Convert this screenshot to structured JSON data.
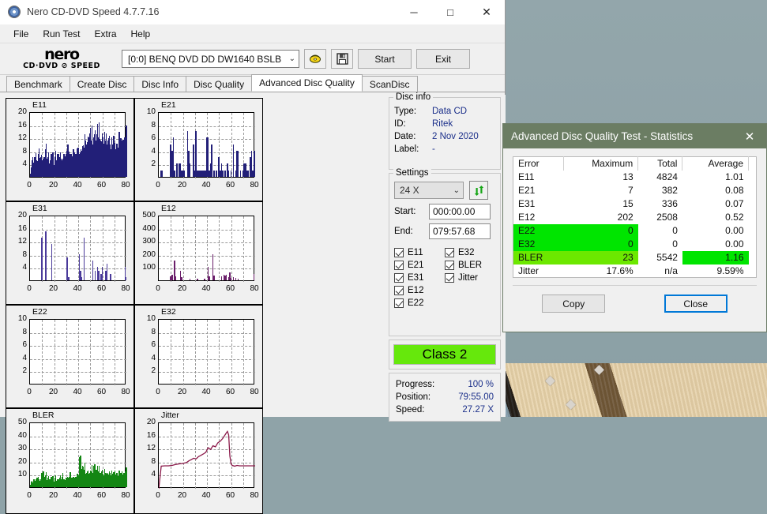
{
  "window": {
    "title": "Nero CD-DVD Speed 4.7.7.16",
    "icon": "nero-disc-icon",
    "minimize": "─",
    "maximize": "□",
    "close": "✕"
  },
  "menubar": {
    "items": [
      "File",
      "Run Test",
      "Extra",
      "Help"
    ]
  },
  "logo": {
    "line1": "nero",
    "line2": "CD·DVD ⊘ SPEED"
  },
  "toolbar": {
    "drive_value": "[0:0]   BENQ DVD DD DW1640 BSLB",
    "chevron": "⌄",
    "eject_icon": "eject-disc-icon",
    "save_icon": "floppy-save-icon",
    "start_label": "Start",
    "exit_label": "Exit"
  },
  "tabs": [
    {
      "label": "Benchmark",
      "active": false
    },
    {
      "label": "Create Disc",
      "active": false
    },
    {
      "label": "Disc Info",
      "active": false
    },
    {
      "label": "Disc Quality",
      "active": false
    },
    {
      "label": "Advanced Disc Quality",
      "active": true
    },
    {
      "label": "ScanDisc",
      "active": false
    }
  ],
  "disc_info": {
    "legend": "Disc info",
    "type_label": "Type:",
    "type_value": "Data CD",
    "id_label": "ID:",
    "id_value": "Ritek",
    "date_label": "Date:",
    "date_value": "2 Nov 2020",
    "label_label": "Label:",
    "label_value": "-"
  },
  "settings": {
    "legend": "Settings",
    "speed_value": "24 X",
    "chevron": "⌄",
    "refresh_icon": "refresh-arrows-icon",
    "start_label": "Start:",
    "start_value": "000:00.00",
    "end_label": "End:",
    "end_value": "079:57.68",
    "checkboxes": [
      {
        "label": "E11",
        "checked": true
      },
      {
        "label": "E32",
        "checked": true
      },
      {
        "label": "E21",
        "checked": true
      },
      {
        "label": "BLER",
        "checked": true
      },
      {
        "label": "E31",
        "checked": true
      },
      {
        "label": "Jitter",
        "checked": true
      },
      {
        "label": "E12",
        "checked": true
      },
      {
        "label": "",
        "checked": false
      },
      {
        "label": "E22",
        "checked": true
      },
      {
        "label": "",
        "checked": false
      }
    ]
  },
  "class_badge": {
    "text": "Class 2",
    "color": "#66e80c"
  },
  "progress": {
    "progress_label": "Progress:",
    "progress_value": "100 %",
    "position_label": "Position:",
    "position_value": "79:55.00",
    "speed_label": "Speed:",
    "speed_value": "27.27 X"
  },
  "stats_dialog": {
    "title": "Advanced Disc Quality Test - Statistics",
    "close_icon": "✕",
    "headers": [
      "Error",
      "Maximum",
      "Total",
      "Average"
    ],
    "rows": [
      {
        "error": "E11",
        "maximum": "13",
        "total": "4824",
        "average": "1.01",
        "hl": "none"
      },
      {
        "error": "E21",
        "maximum": "7",
        "total": "382",
        "average": "0.08",
        "hl": "none"
      },
      {
        "error": "E31",
        "maximum": "15",
        "total": "336",
        "average": "0.07",
        "hl": "none"
      },
      {
        "error": "E12",
        "maximum": "202",
        "total": "2508",
        "average": "0.52",
        "hl": "none"
      },
      {
        "error": "E22",
        "maximum": "0",
        "total": "0",
        "average": "0.00",
        "hl": "green"
      },
      {
        "error": "E32",
        "maximum": "0",
        "total": "0",
        "average": "0.00",
        "hl": "green"
      },
      {
        "error": "BLER",
        "maximum": "23",
        "total": "5542",
        "average": "1.16",
        "hl": "bler"
      },
      {
        "error": "Jitter",
        "maximum": "17.6%",
        "total": "n/a",
        "average": "9.59%",
        "hl": "none"
      }
    ],
    "copy_label": "Copy",
    "close_label": "Close",
    "highlight_green": "#00e500",
    "highlight_lgreen": "#6ce800"
  },
  "chart_data": [
    {
      "type": "bar",
      "title": "E11",
      "xlabel": "",
      "ylabel": "",
      "color": "#221f78",
      "xlim": [
        0,
        80
      ],
      "ylim": [
        0,
        20
      ],
      "xticks": [
        0,
        20,
        40,
        60,
        80
      ],
      "yticks": [
        4,
        8,
        12,
        16,
        20
      ],
      "grid": true,
      "x": [
        0,
        1,
        2,
        3,
        4,
        5,
        6,
        7,
        8,
        9,
        10,
        11,
        12,
        13,
        14,
        15,
        16,
        17,
        18,
        19,
        20,
        21,
        22,
        23,
        24,
        25,
        26,
        27,
        28,
        29,
        30,
        31,
        32,
        33,
        34,
        35,
        36,
        37,
        38,
        39,
        40,
        41,
        42,
        43,
        44,
        45,
        46,
        47,
        48,
        49,
        50,
        51,
        52,
        53,
        54,
        55,
        56,
        57,
        58,
        59,
        60,
        61,
        62,
        63,
        64,
        65,
        66,
        67,
        68,
        69,
        70,
        71,
        72,
        73,
        74,
        75,
        76,
        77,
        78,
        79,
        80
      ],
      "values": [
        1,
        3,
        5,
        4,
        6,
        5,
        4,
        7,
        5,
        6,
        5,
        4,
        6,
        8,
        5,
        6,
        4,
        5,
        7,
        5,
        3,
        6,
        5,
        7,
        4,
        6,
        5,
        4,
        7,
        6,
        5,
        8,
        6,
        5,
        7,
        6,
        8,
        5,
        7,
        6,
        9,
        7,
        6,
        8,
        7,
        9,
        11,
        10,
        9,
        12,
        10,
        11,
        9,
        12,
        10,
        11,
        13,
        12,
        11,
        10,
        12,
        9,
        11,
        10,
        9,
        11,
        10,
        8,
        9,
        10,
        9,
        8,
        10,
        9,
        11,
        10,
        9,
        11,
        10,
        12,
        10
      ]
    },
    {
      "type": "bar",
      "title": "E21",
      "xlabel": "",
      "ylabel": "",
      "color": "#221f78",
      "xlim": [
        0,
        80
      ],
      "ylim": [
        0,
        10
      ],
      "xticks": [
        0,
        20,
        40,
        60,
        80
      ],
      "yticks": [
        2,
        4,
        6,
        8,
        10
      ],
      "grid": true,
      "x": [
        2,
        3,
        10,
        11,
        12,
        13,
        15,
        17,
        18,
        19,
        20,
        21,
        24,
        25,
        26,
        29,
        30,
        31,
        32,
        33,
        34,
        35,
        36,
        37,
        38,
        39,
        40,
        41,
        42,
        43,
        44,
        46,
        48,
        50,
        51,
        52,
        53,
        55,
        57,
        58,
        60,
        62,
        64,
        65,
        66,
        68,
        70,
        71,
        72,
        73,
        74,
        76,
        77,
        78,
        79,
        80
      ],
      "values": [
        1,
        1,
        5,
        4,
        6,
        1,
        2,
        2,
        2,
        1,
        1,
        1,
        7,
        4,
        2,
        5,
        1,
        7,
        1,
        1,
        1,
        1,
        1,
        1,
        1,
        1,
        6,
        6,
        1,
        2,
        5,
        1,
        1,
        3,
        1,
        2,
        1,
        1,
        2,
        1,
        1,
        5,
        1,
        4,
        4,
        1,
        1,
        2,
        2,
        1,
        1,
        3,
        4,
        1,
        1,
        4
      ]
    },
    {
      "type": "bar",
      "title": "E31",
      "xlabel": "",
      "ylabel": "",
      "color": "#4a3a9a",
      "xlim": [
        0,
        80
      ],
      "ylim": [
        0,
        20
      ],
      "xticks": [
        0,
        20,
        40,
        60,
        80
      ],
      "yticks": [
        4,
        8,
        12,
        16,
        20
      ],
      "grid": true,
      "x": [
        10,
        13,
        18,
        31,
        32,
        41,
        42,
        43,
        45,
        52,
        54,
        56,
        57,
        59,
        60,
        63,
        64,
        67,
        79,
        80
      ],
      "values": [
        13,
        15,
        11,
        7,
        1,
        8,
        3,
        1,
        13,
        6,
        3,
        4,
        3,
        2,
        4,
        3,
        5,
        2,
        4,
        1
      ]
    },
    {
      "type": "bar",
      "title": "E12",
      "xlabel": "",
      "ylabel": "",
      "color": "#6b1f6b",
      "xlim": [
        0,
        80
      ],
      "ylim": [
        0,
        500
      ],
      "xticks": [
        0,
        20,
        40,
        60,
        80
      ],
      "yticks": [
        100,
        200,
        300,
        400,
        500
      ],
      "grid": true,
      "x": [
        10,
        11,
        13,
        14,
        18,
        19,
        26,
        32,
        38,
        41,
        42,
        45,
        46,
        52,
        54,
        55,
        56,
        58,
        59,
        60,
        62,
        64,
        66,
        79
      ],
      "values": [
        30,
        40,
        150,
        30,
        70,
        25,
        10,
        10,
        10,
        105,
        30,
        200,
        35,
        30,
        40,
        35,
        45,
        25,
        60,
        20,
        25,
        20,
        15,
        50
      ]
    },
    {
      "type": "bar",
      "title": "E22",
      "xlabel": "",
      "ylabel": "",
      "color": "#221f78",
      "xlim": [
        0,
        80
      ],
      "ylim": [
        0,
        10
      ],
      "xticks": [
        0,
        20,
        40,
        60,
        80
      ],
      "yticks": [
        2,
        4,
        6,
        8,
        10
      ],
      "grid": true,
      "x": [],
      "values": []
    },
    {
      "type": "bar",
      "title": "E32",
      "xlabel": "",
      "ylabel": "",
      "color": "#221f78",
      "xlim": [
        0,
        80
      ],
      "ylim": [
        0,
        10
      ],
      "xticks": [
        0,
        20,
        40,
        60,
        80
      ],
      "yticks": [
        2,
        4,
        6,
        8,
        10
      ],
      "grid": true,
      "x": [],
      "values": []
    },
    {
      "type": "bar",
      "title": "BLER",
      "xlabel": "",
      "ylabel": "",
      "color": "#138613",
      "xlim": [
        0,
        80
      ],
      "ylim": [
        0,
        50
      ],
      "xticks": [
        0,
        20,
        40,
        60,
        80
      ],
      "yticks": [
        10,
        20,
        30,
        40,
        50
      ],
      "grid": true,
      "x": [
        0,
        1,
        2,
        3,
        4,
        5,
        6,
        7,
        8,
        9,
        10,
        11,
        12,
        13,
        14,
        15,
        16,
        17,
        18,
        19,
        20,
        21,
        22,
        23,
        24,
        25,
        26,
        27,
        28,
        29,
        30,
        31,
        32,
        33,
        34,
        35,
        36,
        37,
        38,
        39,
        40,
        41,
        42,
        43,
        44,
        45,
        46,
        47,
        48,
        49,
        50,
        51,
        52,
        53,
        54,
        55,
        56,
        57,
        58,
        59,
        60,
        61,
        62,
        63,
        64,
        65,
        66,
        67,
        68,
        69,
        70,
        71,
        72,
        73,
        74,
        75,
        76,
        77,
        78,
        79,
        80
      ],
      "values": [
        2,
        4,
        3,
        6,
        5,
        4,
        7,
        5,
        4,
        6,
        11,
        8,
        6,
        9,
        5,
        7,
        6,
        4,
        8,
        5,
        4,
        7,
        5,
        6,
        4,
        7,
        5,
        8,
        6,
        5,
        7,
        6,
        5,
        8,
        6,
        7,
        5,
        6,
        8,
        7,
        9,
        23,
        12,
        14,
        10,
        13,
        9,
        11,
        8,
        10,
        9,
        12,
        10,
        16,
        11,
        13,
        10,
        12,
        9,
        11,
        10,
        9,
        11,
        8,
        10,
        9,
        11,
        8,
        10,
        9,
        11,
        9,
        10,
        8,
        11,
        9,
        10,
        9,
        11,
        10,
        12
      ]
    },
    {
      "type": "line",
      "title": "Jitter",
      "xlabel": "",
      "ylabel": "",
      "color": "#8b1a4a",
      "xlim": [
        0,
        80
      ],
      "ylim": [
        0,
        20
      ],
      "xticks": [
        0,
        20,
        40,
        60,
        80
      ],
      "yticks": [
        4,
        8,
        12,
        16,
        20
      ],
      "grid": true,
      "x": [
        0,
        2,
        5,
        8,
        11,
        14,
        17,
        20,
        23,
        25,
        27,
        29,
        31,
        33,
        35,
        37,
        39,
        41,
        43,
        45,
        47,
        49,
        51,
        53,
        55,
        56,
        57,
        58,
        59,
        60,
        61,
        63,
        65,
        67,
        70,
        73,
        76,
        80
      ],
      "values": [
        0,
        6.9,
        7.0,
        7.0,
        7.1,
        7.4,
        7.6,
        7.7,
        8.0,
        8.5,
        8.9,
        9.3,
        9.1,
        9.8,
        10.2,
        10.6,
        11.1,
        12.5,
        12.0,
        13.1,
        12.8,
        14.0,
        14.5,
        15.3,
        16.4,
        17.0,
        17.5,
        16.4,
        10.0,
        7.6,
        7.1,
        6.9,
        7.1,
        7.0,
        7.0,
        7.0,
        7.0,
        7.0
      ]
    }
  ]
}
